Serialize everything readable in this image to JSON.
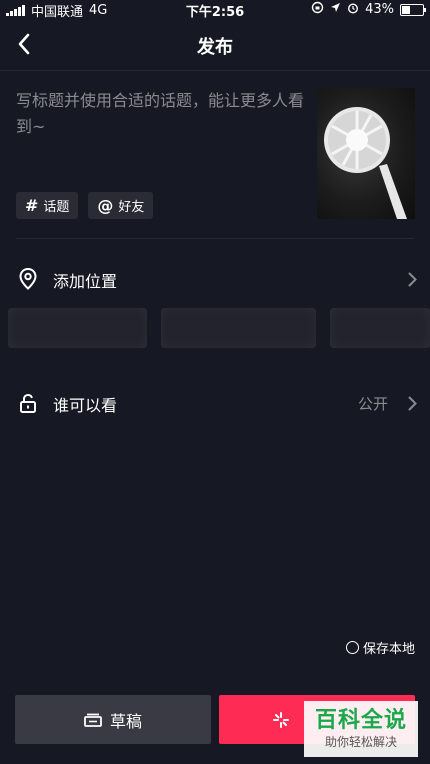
{
  "status_bar": {
    "carrier": "中国联通",
    "network": "4G",
    "time": "下午2:56",
    "battery": "43%",
    "battery_level": 0.43
  },
  "header": {
    "title": "发布"
  },
  "compose": {
    "placeholder": "写标题并使用合适的话题，能让更多人看到~",
    "chips": [
      {
        "symbol": "#",
        "label": "话题"
      },
      {
        "symbol": "@",
        "label": "好友"
      }
    ]
  },
  "location": {
    "label": "添加位置"
  },
  "privacy": {
    "label": "谁可以看",
    "value": "公开"
  },
  "footer": {
    "save_local": "保存本地",
    "draft_label": "草稿"
  },
  "watermark": {
    "title": "百科全说",
    "subtitle": "助你轻松解决"
  },
  "colors": {
    "background": "#161823",
    "accent": "#fe2c55",
    "secondary_button": "#393a43",
    "muted_text": "#8a8b91"
  }
}
